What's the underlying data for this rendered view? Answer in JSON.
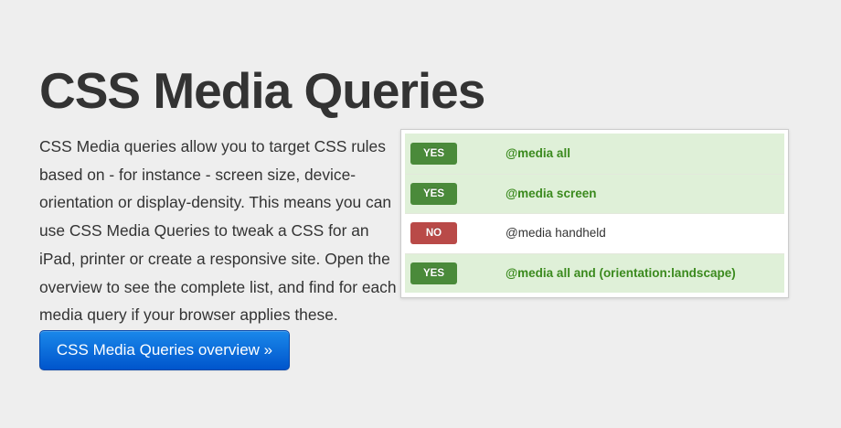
{
  "page": {
    "title": "CSS Media Queries",
    "intro": "CSS Media queries allow you to target CSS rules based on - for instance - screen size, device-orientation or display-density. This means you can use CSS Media Queries to tweak a CSS for an iPad, printer or create a responsive site. Open the overview to see the complete list, and find for each media query if your browser applies these."
  },
  "cta": {
    "label": "CSS Media Queries overview »"
  },
  "results": [
    {
      "status": "YES",
      "query": "@media all",
      "supported": true,
      "row_height": 44
    },
    {
      "status": "YES",
      "query": "@media screen",
      "supported": true,
      "row_height": 43
    },
    {
      "status": "NO",
      "query": "@media handheld",
      "supported": false,
      "row_height": 44
    },
    {
      "status": "YES",
      "query": "@media all and (orientation:landscape)",
      "supported": true,
      "row_height": 43
    }
  ],
  "colors": {
    "yes_badge": "#4a8a3a",
    "no_badge": "#b94a48",
    "yes_row_bg": "#dff0d8",
    "no_row_bg": "#ffffff",
    "yes_text": "#3b8a1e",
    "no_text": "#333333",
    "button_top": "#1a88ea",
    "button_bottom": "#0055cc"
  }
}
